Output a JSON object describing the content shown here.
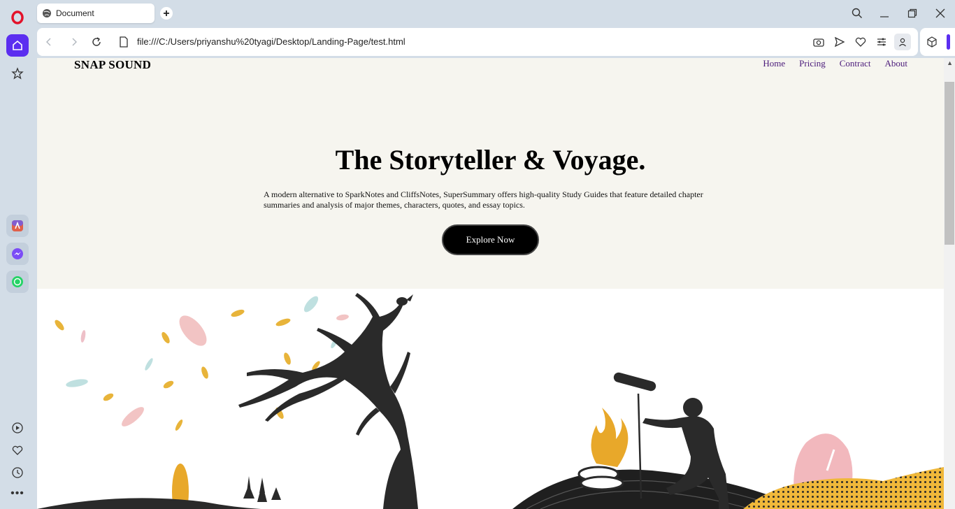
{
  "browser": {
    "tab": {
      "title": "Document"
    },
    "address": {
      "url": "file:///C:/Users/priyanshu%20tyagi/Desktop/Landing-Page/test.html"
    }
  },
  "page": {
    "brand": "SNAP SOUND",
    "nav": [
      "Home",
      "Pricing",
      "Contract",
      "About"
    ],
    "hero": {
      "title": "The Storyteller & Voyage.",
      "description": "A modern alternative to SparkNotes and CliffsNotes, SuperSummary offers high-quality Study Guides that feature detailed chapter summaries and analysis of major themes, characters, quotes, and essay topics.",
      "cta_label": "Explore Now"
    }
  },
  "colors": {
    "accent": "#5b2ef0",
    "hero_bg": "#f6f5ef",
    "nav_link": "#4a1a7a",
    "cta_bg": "#000000"
  }
}
